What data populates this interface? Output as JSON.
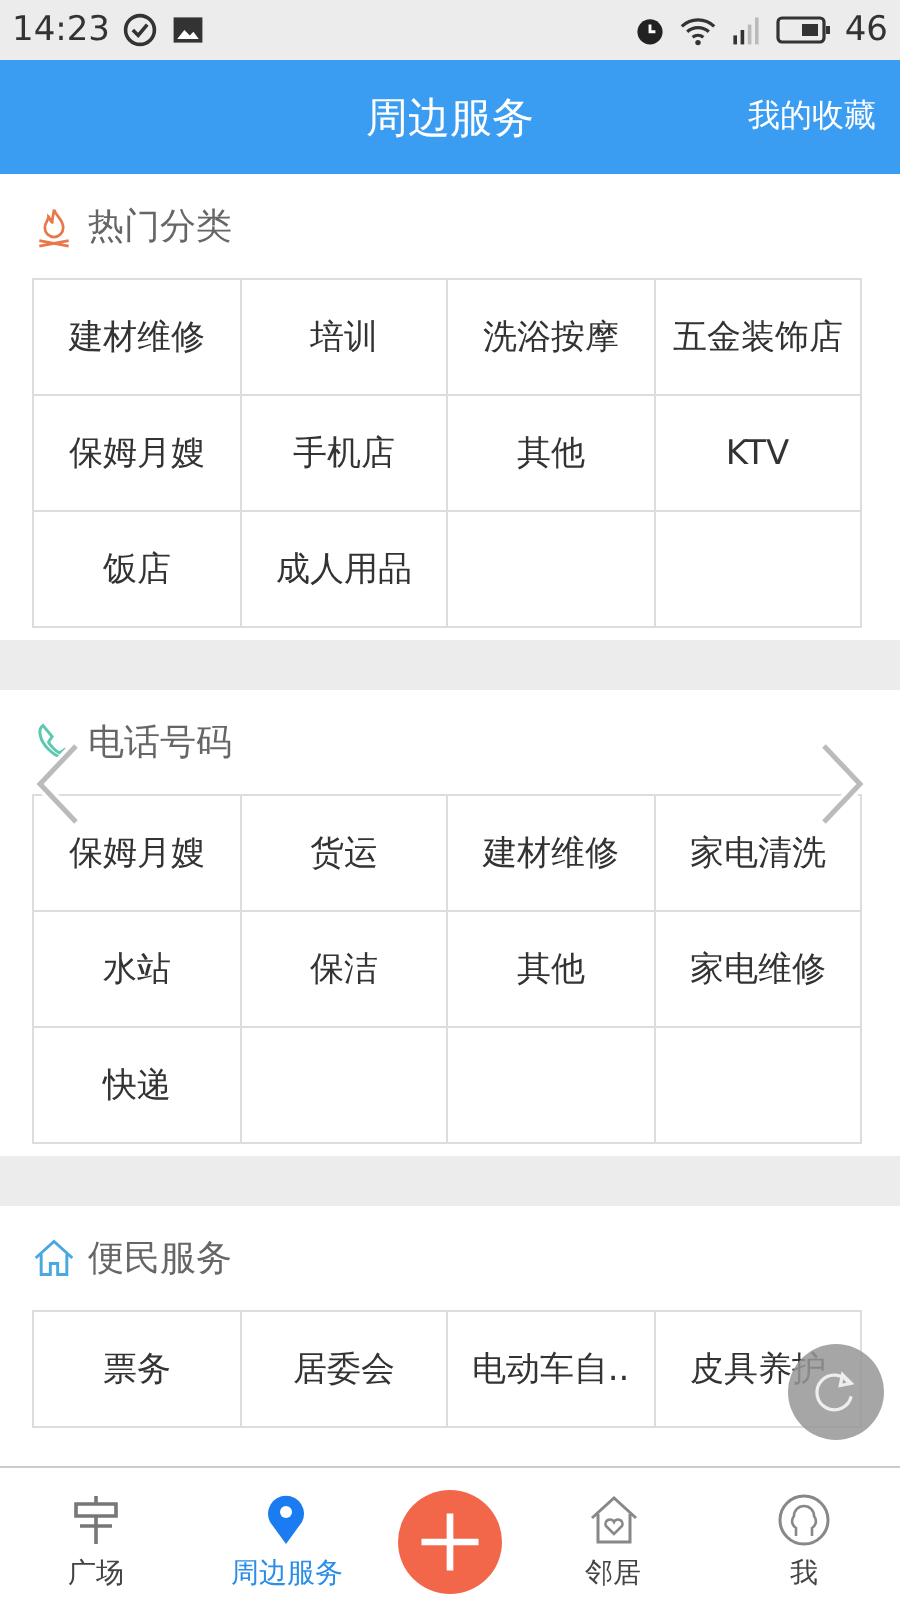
{
  "status_bar": {
    "time": "14:23",
    "battery": "46"
  },
  "header": {
    "title": "周边服务",
    "action": "我的收藏"
  },
  "sections": [
    {
      "title": "热门分类",
      "kind": "hot",
      "carousel": false,
      "items": [
        "建材维修",
        "培训",
        "洗浴按摩",
        "五金装饰店",
        "保姆月嫂",
        "手机店",
        "其他",
        "KTV",
        "饭店",
        "成人用品"
      ]
    },
    {
      "title": "电话号码",
      "kind": "phone",
      "carousel": true,
      "items": [
        "保姆月嫂",
        "货运",
        "建材维修",
        "家电清洗",
        "水站",
        "保洁",
        "其他",
        "家电维修",
        "快递"
      ]
    },
    {
      "title": "便民服务",
      "kind": "home",
      "carousel": false,
      "items": [
        "票务",
        "居委会",
        "电动车自..",
        "皮具养护"
      ]
    }
  ],
  "bottom_nav": [
    {
      "kind": "tab",
      "label": "广场",
      "selected": false
    },
    {
      "kind": "tab",
      "label": "周边服务",
      "selected": true
    },
    {
      "kind": "add"
    },
    {
      "kind": "tab",
      "label": "邻居",
      "selected": false
    },
    {
      "kind": "tab",
      "label": "我",
      "selected": false
    }
  ]
}
